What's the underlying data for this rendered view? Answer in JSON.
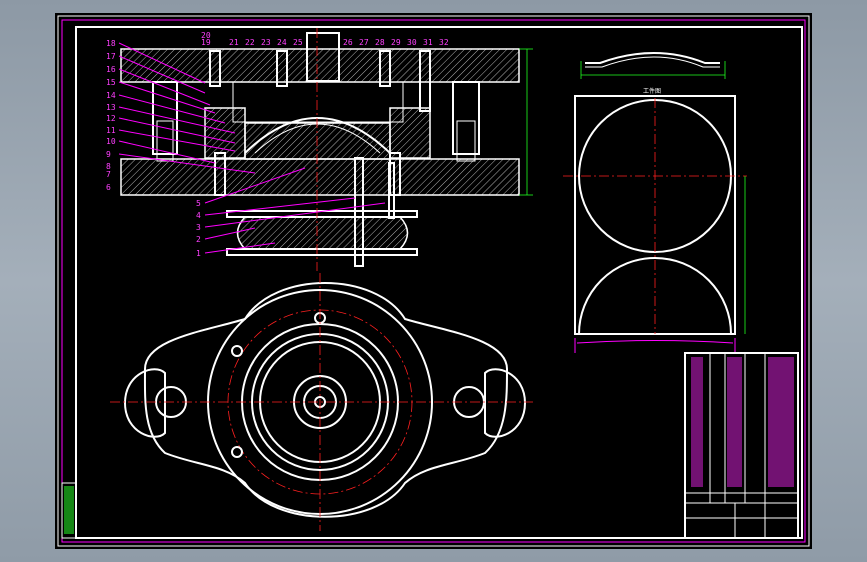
{
  "part_numbers_top": [
    "20",
    "19",
    "21",
    "22",
    "23",
    "24",
    "25",
    "26",
    "27",
    "28",
    "29",
    "30",
    "31",
    "32"
  ],
  "part_numbers_left": [
    "18",
    "17",
    "16",
    "15",
    "14",
    "13",
    "12",
    "11",
    "10",
    "9",
    "8",
    "7",
    "6",
    "5",
    "4",
    "3",
    "2",
    "1"
  ],
  "workpiece_label": "工件图",
  "title_block": {
    "label_a": "",
    "label_b": ""
  }
}
